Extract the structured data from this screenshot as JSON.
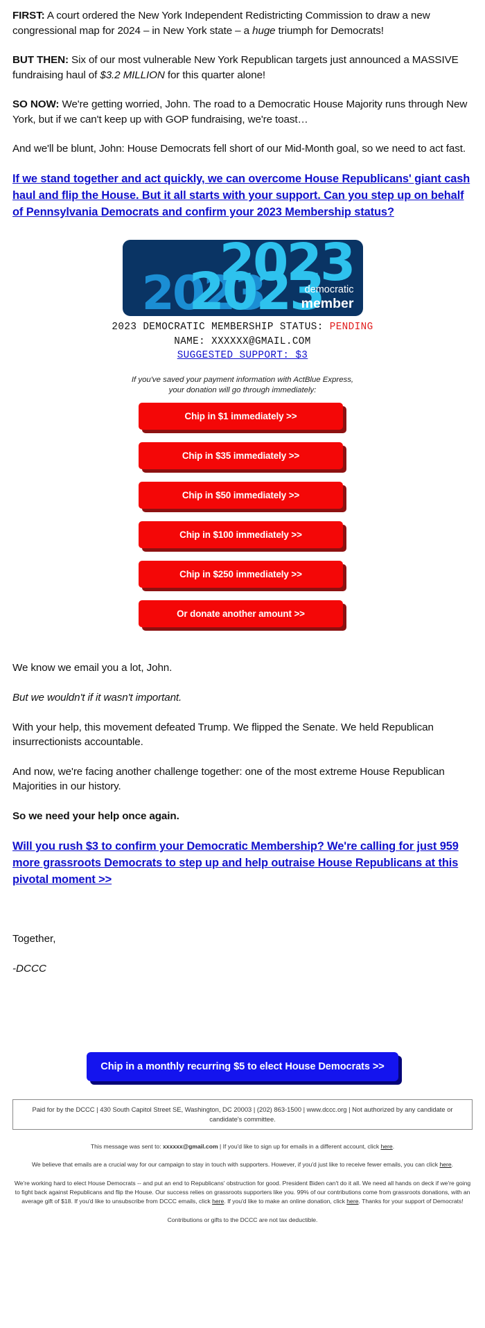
{
  "email": {
    "paragraphs": [
      {
        "lead": "FIRST:",
        "text_before": " A court ordered the New York Independent Redistricting Commission to draw a new congressional map for 2024 – in New York state – a ",
        "italic": "huge",
        "text_after": " triumph for Democrats!"
      },
      {
        "lead": "BUT THEN:",
        "text_before": " Six of our most vulnerable New York Republican targets just announced a MASSIVE fundraising haul of ",
        "italic": "$3.2 MILLION",
        "text_after": " for this quarter alone!"
      },
      {
        "lead": "SO NOW:",
        "text_before": " We're getting worried, John. The road to a Democratic House Majority runs through New York, but if we can't keep up with GOP fundraising, we're toast…",
        "italic": "",
        "text_after": ""
      },
      {
        "lead": "",
        "text_before": "And we'll be blunt, John: House Democrats fell short of our Mid-Month goal, so we need to act fast.",
        "italic": "",
        "text_after": ""
      }
    ],
    "main_link": "If we stand together and act quickly, we can overcome House Republicans' giant cash haul and flip the House. But it all starts with your support. Can you step up on behalf of Pennsylvania Democrats and confirm your 2023 Membership status? "
  },
  "card": {
    "year_back": "2023",
    "year_front": "2023",
    "year_front2": "2023",
    "label_democratic": "democratic",
    "label_member": "member",
    "bg_color": "#0a3464",
    "year_back_color": "#1b8ed4",
    "year_front_color": "#2ec2ee"
  },
  "status": {
    "line1_prefix": "2023 DEMOCRATIC MEMBERSHIP STATUS: ",
    "line1_value": "PENDING",
    "line1_value_color": "#e01b1b",
    "line2": "NAME: XXXXXX@GMAIL.COM",
    "line3": "SUGGESTED SUPPORT: $3"
  },
  "express_note": "If you've saved your payment information with ActBlue Express, your donation will go through immediately:",
  "donate_buttons": [
    {
      "label": "Chip in $1 immediately >>"
    },
    {
      "label": "Chip in $35 immediately >>"
    },
    {
      "label": "Chip in $50 immediately >>"
    },
    {
      "label": "Chip in $100 immediately >>"
    },
    {
      "label": "Chip in $250 immediately >>"
    },
    {
      "label": "Or donate another amount >>"
    }
  ],
  "lower": {
    "p1": "We know we email you a lot, John.",
    "p2_italic": "But we wouldn't if it wasn't important.",
    "p3": "With your help, this movement defeated Trump. We flipped the Senate. We held Republican insurrectionists accountable.",
    "p4": "And now, we're facing another challenge together: one of the most extreme House Republican Majorities in our history.",
    "p5_bold": "So we need your help once again.",
    "closing_link": "Will you rush $3 to confirm your Democratic Membership? We're calling for just 959 more grassroots Democrats to step up and help outraise House Republicans at this pivotal moment >>",
    "sign_together": "Together,",
    "sign_name": "-DCCC"
  },
  "monthly_button": {
    "label": "Chip in a monthly recurring $5 to elect House Democrats >>",
    "bg_color": "#1414ee"
  },
  "footer": {
    "paid_for": "Paid for by the DCCC | 430 South Capitol Street SE, Washington, DC 20003 | (202) 863-1500 | www.dccc.org | Not authorized by any candidate or candidate's committee.",
    "sent_to_prefix": "This message was sent to: ",
    "sent_to_email": "xxxxxx@gmail.com",
    "sent_to_suffix_a": " | If you'd like to sign up for emails in a different account, click ",
    "sent_to_link": "here",
    "sent_to_end": ".",
    "fewer_emails_a": "We believe that emails are a crucial way for our campaign to stay in touch with supporters. However, if you'd just like to receive fewer emails, you can click ",
    "fewer_emails_link": "here",
    "fewer_emails_end": ".",
    "long_a": "We're working hard to elect House Democrats -- and put an end to Republicans' obstruction for good. President Biden can't do it all. We need all hands on deck if we're going to fight back against Republicans and flip the House. Our success relies on grassroots supporters like you. 99% of our contributions come from grassroots donations, with an average gift of $18. If you'd like to unsubscribe from DCCC emails, click ",
    "long_link1": "here",
    "long_b": ". If you'd like to make an online donation, click ",
    "long_link2": "here",
    "long_c": ". Thanks for your support of Democrats!",
    "tax": "Contributions or gifts to the DCCC are not tax deductible."
  }
}
